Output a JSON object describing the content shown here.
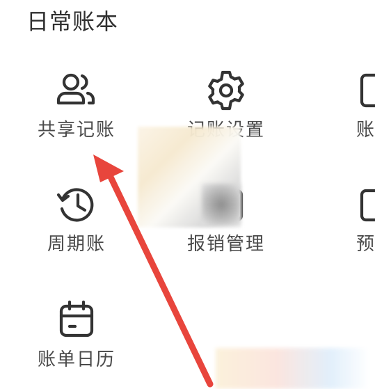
{
  "section": {
    "title": "日常账本"
  },
  "items": [
    {
      "label": "共享记账",
      "icon": "people-icon"
    },
    {
      "label": "记账设置",
      "icon": "gear-icon"
    },
    {
      "label": "账单",
      "icon": "document-icon"
    },
    {
      "label": "周期账",
      "icon": "history-clock-icon"
    },
    {
      "label": "报销管理",
      "icon": "reimburse-icon"
    },
    {
      "label": "预算",
      "icon": "budget-icon"
    },
    {
      "label": "账单日历",
      "icon": "calendar-icon"
    }
  ],
  "colors": {
    "icon_stroke": "#333333",
    "label": "#4a4a4a",
    "arrow": "#e8453c"
  }
}
